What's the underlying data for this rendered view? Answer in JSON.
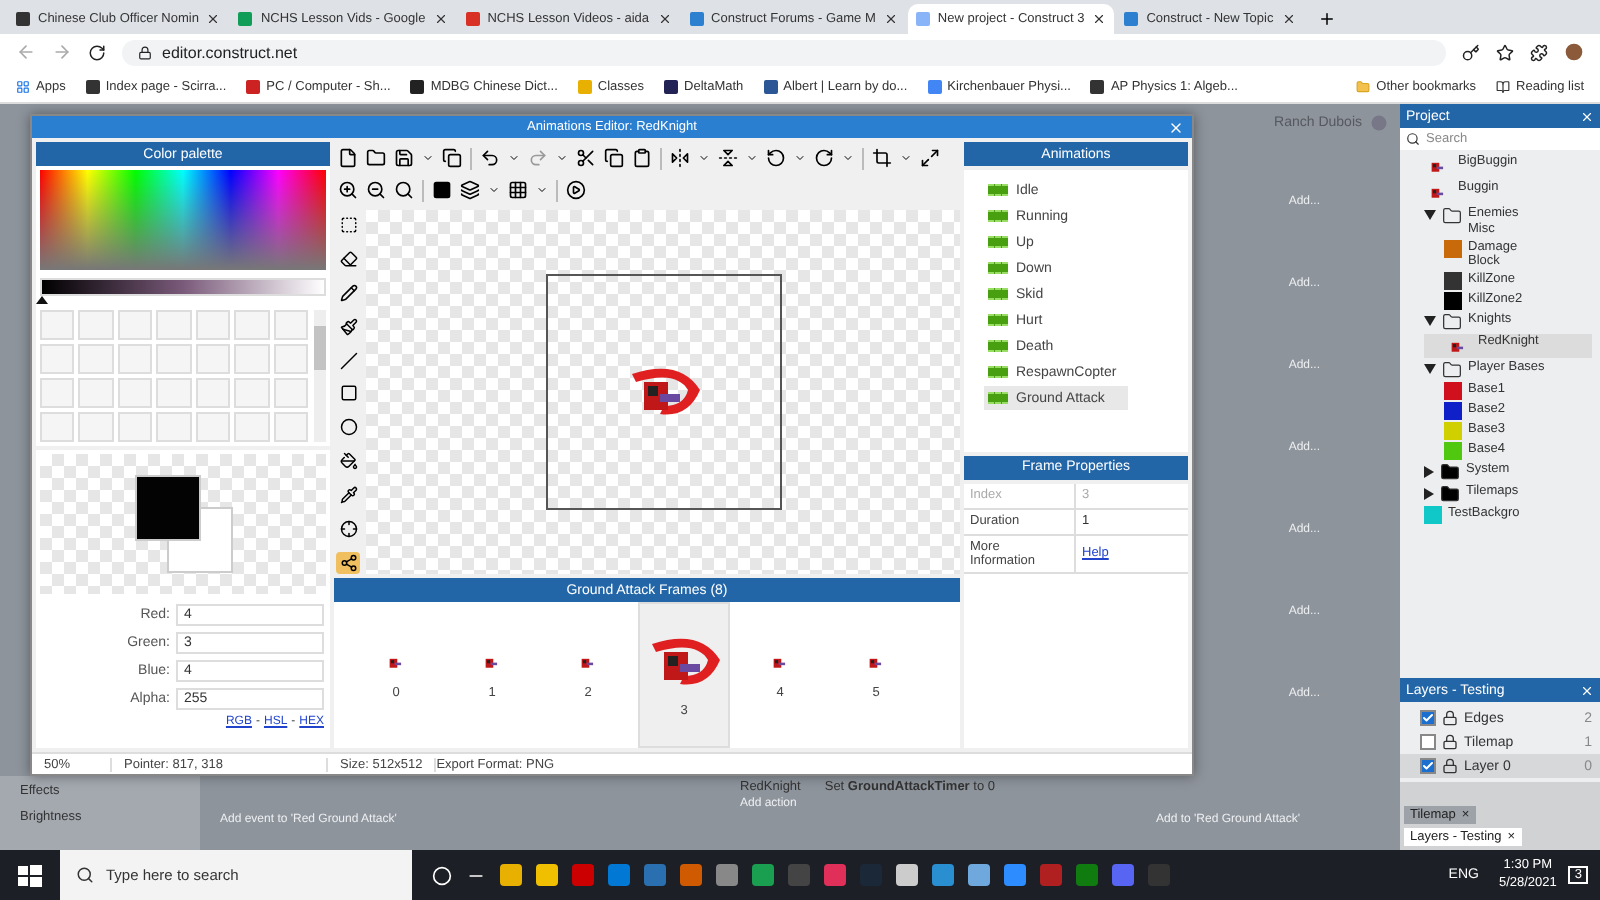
{
  "browser": {
    "tabs": [
      {
        "title": "Chinese Club Officer Nomin",
        "selected": false
      },
      {
        "title": "NCHS Lesson Vids - Google",
        "selected": false
      },
      {
        "title": "NCHS Lesson Videos - aida",
        "selected": false
      },
      {
        "title": "Construct Forums - Game M",
        "selected": false
      },
      {
        "title": "New project - Construct 3",
        "selected": true
      },
      {
        "title": "Construct - New Topic",
        "selected": false
      }
    ],
    "address": "editor.construct.net",
    "bookmarks": [
      "Apps",
      "Index page - Scirra...",
      "PC / Computer - Sh...",
      "MDBG Chinese Dict...",
      "Classes",
      "DeltaMath",
      "Albert | Learn by do...",
      "Kirchenbauer Physi...",
      "AP Physics 1: Algeb..."
    ],
    "other_bookmarks": "Other bookmarks",
    "reading_list": "Reading list"
  },
  "workspace": {
    "user": "Ranch Dubois",
    "add_links": [
      "Add...",
      "Add...",
      "Add...",
      "Add...",
      "Add...",
      "Add...",
      "Add..."
    ],
    "properties": [
      "Effects",
      "Brightness"
    ],
    "event": {
      "object": "RedKnight",
      "action": "Set **GroundAttackTimer** to 0",
      "add_action": "Add action",
      "add_event": "Add event to 'Red Ground Attack'",
      "add_to": "Add to 'Red Ground Attack'"
    }
  },
  "dialog": {
    "title": "Animations Editor: RedKnight",
    "palette": {
      "title": "Color palette",
      "channels": [
        {
          "label": "Red:",
          "value": "4"
        },
        {
          "label": "Green:",
          "value": "3"
        },
        {
          "label": "Blue:",
          "value": "4"
        },
        {
          "label": "Alpha:",
          "value": "255"
        }
      ],
      "links": [
        "RGB",
        "HSL",
        "HEX"
      ],
      "separator": "-",
      "lightness": {
        "level": 0
      }
    },
    "frames": {
      "title": "Ground Attack Frames (8)",
      "items": [
        {
          "label": "0",
          "selected": false
        },
        {
          "label": "1",
          "selected": false
        },
        {
          "label": "2",
          "selected": false
        },
        {
          "label": "3",
          "selected": true
        },
        {
          "label": "4",
          "selected": false
        },
        {
          "label": "5",
          "selected": false
        }
      ]
    },
    "animations": {
      "title": "Animations",
      "items": [
        {
          "name": "Idle",
          "selected": false
        },
        {
          "name": "Running",
          "selected": false
        },
        {
          "name": "Up",
          "selected": false
        },
        {
          "name": "Down",
          "selected": false
        },
        {
          "name": "Skid",
          "selected": false
        },
        {
          "name": "Hurt",
          "selected": false
        },
        {
          "name": "Death",
          "selected": false
        },
        {
          "name": "RespawnCopter",
          "selected": false
        },
        {
          "name": "Ground Attack",
          "selected": true
        }
      ]
    },
    "frame_properties": {
      "title": "Frame Properties",
      "rows": [
        {
          "label": "Index",
          "value": "3",
          "kind": "readonly"
        },
        {
          "label": "Duration",
          "value": "1",
          "kind": "field"
        },
        {
          "label": "More Information",
          "value": "Help",
          "kind": "link"
        }
      ]
    },
    "status": {
      "zoom": "50%",
      "pointer": "Pointer: 817, 318",
      "size": "Size: 512x512",
      "export": "Export Format: PNG"
    }
  },
  "project": {
    "title": "Project",
    "search": {
      "placeholder": "Search"
    },
    "items": [
      {
        "name": "BigBuggin",
        "kind": "sprite"
      },
      {
        "name": "Buggin",
        "kind": "sprite"
      },
      {
        "name": "Enemies Misc",
        "kind": "folder",
        "expanded": true,
        "children": [
          {
            "name": "Damage Block",
            "kind": "swatch",
            "color": "#c86a0a"
          },
          {
            "name": "KillZone",
            "kind": "swatch",
            "color": "#333333"
          },
          {
            "name": "KillZone2",
            "kind": "swatch",
            "color": "#000000"
          }
        ]
      },
      {
        "name": "Knights",
        "kind": "folder",
        "expanded": true,
        "children": [
          {
            "name": "RedKnight",
            "kind": "sprite",
            "selected": true
          }
        ]
      },
      {
        "name": "Player Bases",
        "kind": "folder",
        "expanded": true,
        "children": [
          {
            "name": "Base1",
            "kind": "swatch",
            "color": "#d0101c"
          },
          {
            "name": "Base2",
            "kind": "swatch",
            "color": "#1020c8"
          },
          {
            "name": "Base3",
            "kind": "swatch",
            "color": "#d0d000"
          },
          {
            "name": "Base4",
            "kind": "swatch",
            "color": "#50c810"
          }
        ]
      },
      {
        "name": "System",
        "kind": "folder",
        "expanded": false
      },
      {
        "name": "Tilemaps",
        "kind": "folder",
        "expanded": false
      },
      {
        "name": "TestBackgro",
        "kind": "swatch",
        "color": "#10c8c8"
      }
    ]
  },
  "layers": {
    "title": "Layers - Testing",
    "items": [
      {
        "name": "Edges",
        "checked": true,
        "count": "2",
        "selected": false
      },
      {
        "name": "Tilemap",
        "checked": false,
        "count": "1",
        "selected": false
      },
      {
        "name": "Layer 0",
        "checked": true,
        "count": "0",
        "selected": true
      }
    ]
  },
  "bottom_tabs": [
    {
      "label": "Tilemap",
      "selected": false,
      "close": "×"
    },
    {
      "label": "Layers - Testing",
      "selected": true,
      "close": "×"
    }
  ],
  "taskbar": {
    "search": {
      "placeholder": "Type here to search"
    },
    "language": "ENG",
    "time": "1:30 PM",
    "date": "5/28/2021",
    "notifications": "3"
  }
}
